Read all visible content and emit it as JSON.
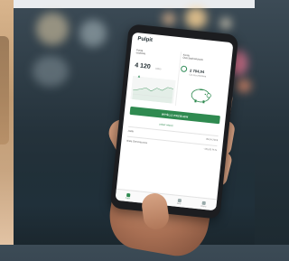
{
  "app": {
    "title": "Pulpit",
    "left_tile": {
      "title_line1": "Konta",
      "title_line2": "osobiste",
      "value": "4 120",
      "unit": "(zł/ks)"
    },
    "right_tile": {
      "title_line1": "Konto",
      "title_line2": "Oszczędnościowe",
      "value": "2 704,94",
      "sub_line1": "Cel",
      "sub_line2": "oszczędzania"
    },
    "cta_label": "WYŚLIJ PRZELEW",
    "link_label": "pokaż więcej",
    "rows": [
      {
        "left": "Jodła",
        "right": "09.04.2019"
      },
      {
        "left": "Biała Ziemniaczyna",
        "right": "-125,00 PLN"
      }
    ],
    "tabs": [
      {
        "label": "Pulpit",
        "active": true
      },
      {
        "label": "Przelewy",
        "active": false
      },
      {
        "label": "Karty",
        "active": false
      },
      {
        "label": "Więcej",
        "active": false
      }
    ]
  },
  "colors": {
    "accent": "#2f8a50",
    "phone_body": "#1c1d20",
    "screen_bg": "#ffffff"
  },
  "icons": [
    "savings-piggy-icon",
    "trend-up-icon",
    "home-icon",
    "transfer-icon",
    "card-icon",
    "more-icon"
  ]
}
